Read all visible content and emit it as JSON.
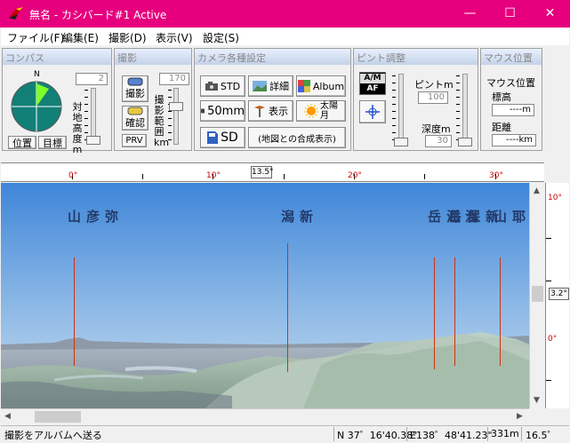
{
  "window": {
    "title": "無名 - カシバード#1 Active",
    "minimize": "—",
    "maximize": "☐",
    "close": "✕"
  },
  "menu": [
    "ファイル(F)",
    "編集(E)",
    "撮影(D)",
    "表示(V)",
    "設定(S)"
  ],
  "compass": {
    "title": "コンパス",
    "north": "N",
    "height_value": "2",
    "height_label": "対地高度m",
    "btn_position": "位置",
    "btn_target": "目標"
  },
  "shoot": {
    "title": "撮影",
    "btn_shoot": "撮影",
    "btn_confirm": "確認",
    "btn_prv": "PRV",
    "range_value": "170",
    "range_label": "撮影範囲km"
  },
  "camera": {
    "title": "カメラ各種設定",
    "btn_std": "STD",
    "btn_detail": "詳細",
    "btn_album": "Album",
    "btn_50mm": "50mm",
    "btn_display": "表示",
    "btn_sun": "太陽",
    "btn_sun2": "月",
    "btn_sd": "SD",
    "btn_composite": "(地図との合成表示)"
  },
  "focus": {
    "title": "ピント調整",
    "am_label": "A/M",
    "af_label": "AF",
    "focus_label": "ピントm",
    "focus_value": "100",
    "depth_label": "深度m",
    "depth_value": "30"
  },
  "mouse": {
    "title": "マウス位置",
    "subtitle": "マウス位置",
    "elev_label": "標高",
    "elev_value": "----m",
    "dist_label": "距離",
    "dist_value": "----km"
  },
  "ruler": {
    "labels": [
      "0°",
      "10°",
      "20°",
      "30°"
    ],
    "cursor": "13.5°"
  },
  "vruler": {
    "top": "10°",
    "bottom": "0°",
    "cursor": "3.2°"
  },
  "peaks": [
    {
      "name": "弥彦山"
    },
    {
      "name": "新潟"
    },
    {
      "name": "温海岳"
    },
    {
      "name": "新保岳"
    },
    {
      "name": "摩耶山"
    }
  ],
  "status": {
    "message": "撮影をアルバムへ送る",
    "lat": "N 37゜16'40.38\"",
    "lon": "E138゜48'41.23\"",
    "elev": "331m",
    "angle": "16.5゜"
  }
}
